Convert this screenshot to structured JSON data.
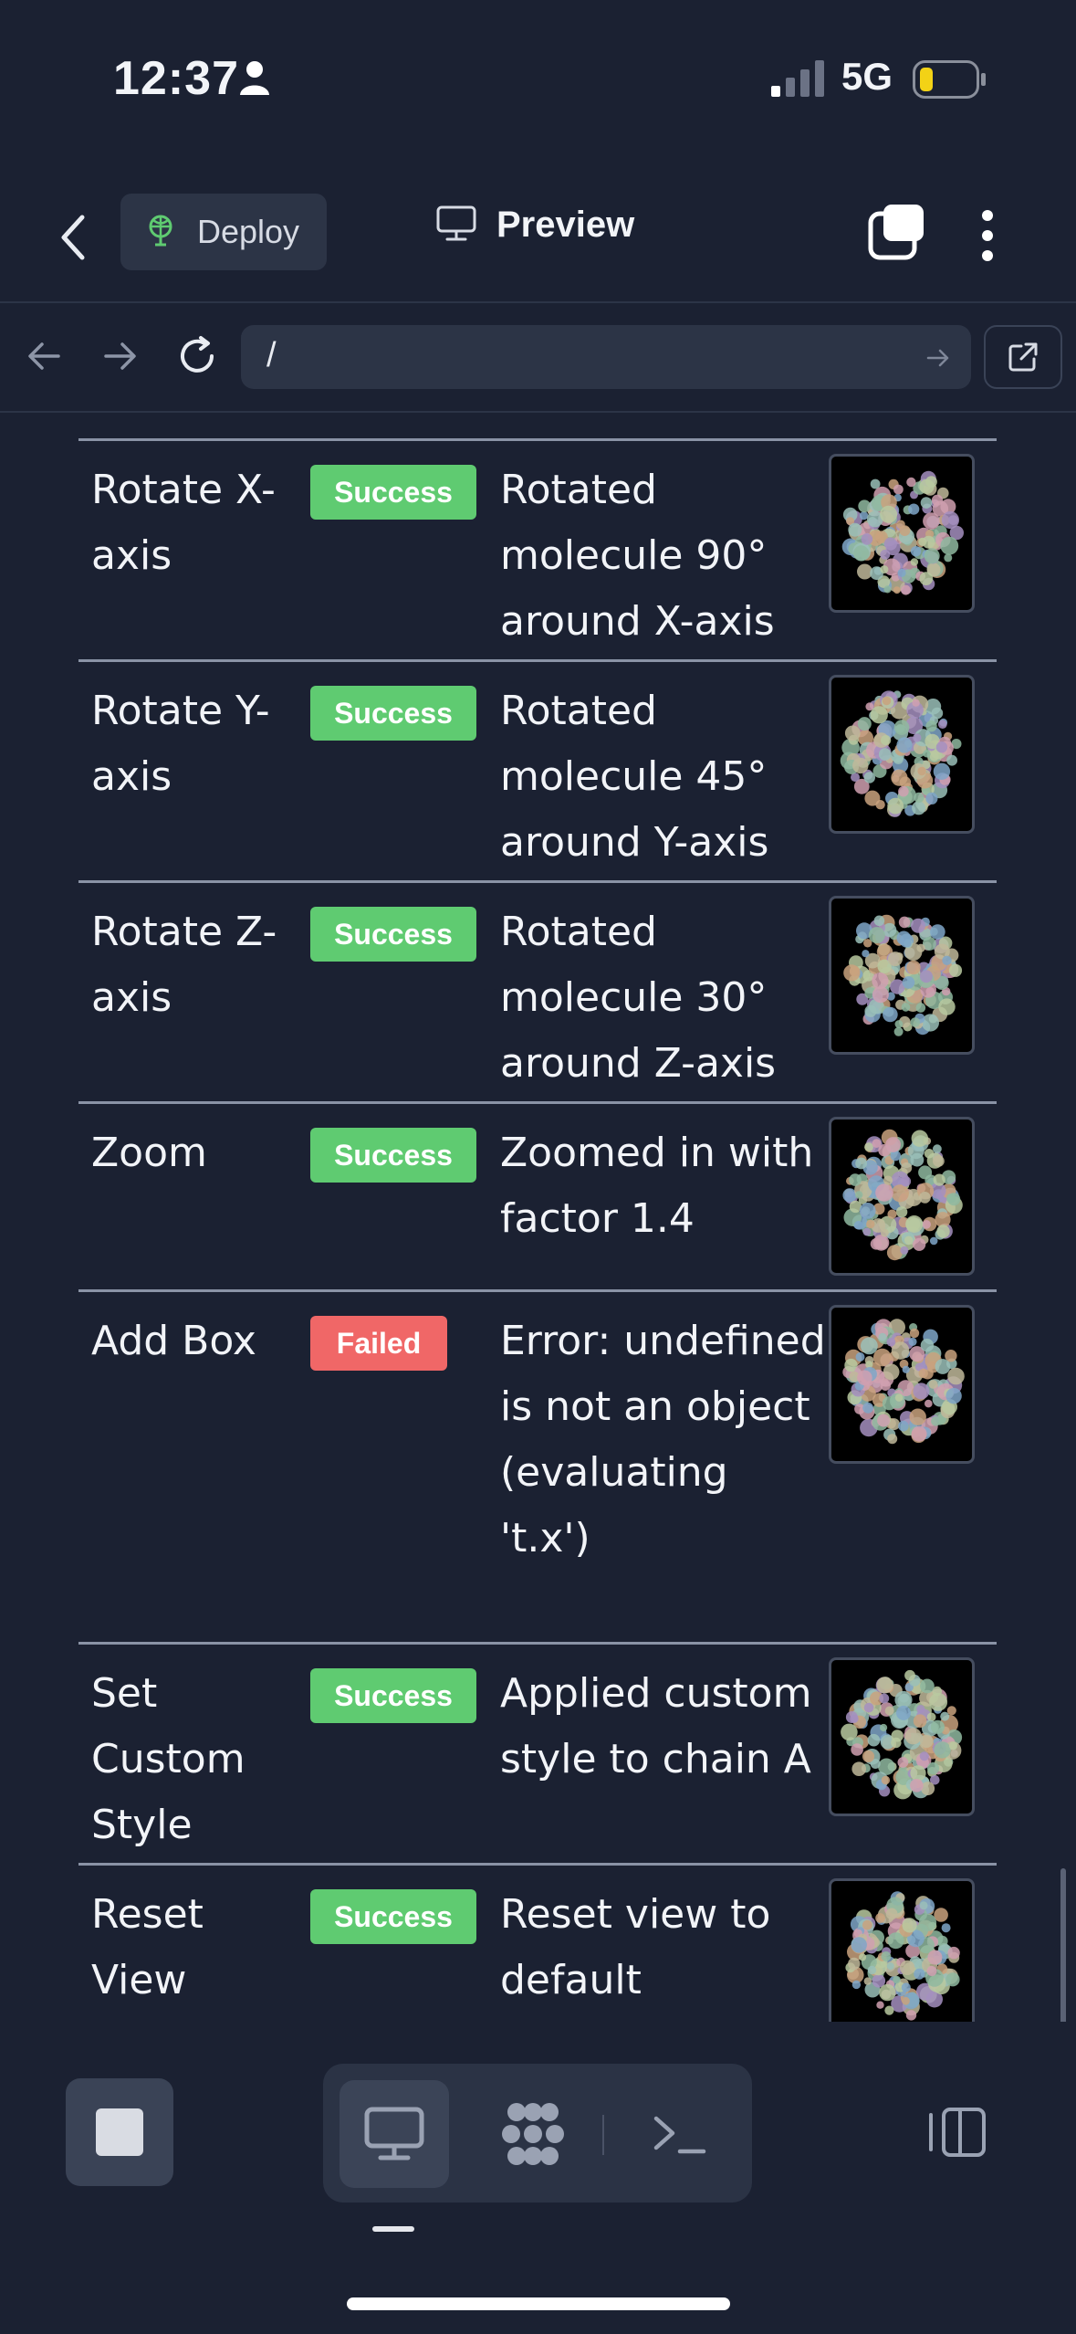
{
  "status_bar": {
    "time": "12:37",
    "network": "5G"
  },
  "header": {
    "deploy_label": "Deploy",
    "preview_label": "Preview"
  },
  "url_bar": {
    "path": "/"
  },
  "rows": [
    {
      "name": "Rotate X-axis",
      "status": "Success",
      "description": "Rotated molecule 90° around X-axis"
    },
    {
      "name": "Rotate Y-axis",
      "status": "Success",
      "description": "Rotated molecule 45° around Y-axis"
    },
    {
      "name": "Rotate Z-axis",
      "status": "Success",
      "description": "Rotated molecule 30° around Z-axis"
    },
    {
      "name": "Zoom",
      "status": "Success",
      "description": "Zoomed in with factor 1.4"
    },
    {
      "name": "Add Box",
      "status": "Failed",
      "description": "Error: undefined is not an object (evaluating 't.x')"
    },
    {
      "name": "Set Custom Style",
      "status": "Success",
      "description": "Applied custom style to chain A"
    },
    {
      "name": "Reset View",
      "status": "Success",
      "description": "Reset view to default"
    }
  ],
  "colors": {
    "success": "#5fcb71",
    "failed": "#f06767",
    "background": "#1b2132"
  },
  "icons": {
    "header": [
      "chevron-left-icon",
      "deploy-icon",
      "monitor-icon",
      "tabs-icon",
      "more-vertical-icon"
    ],
    "toolbar": [
      "stop-icon",
      "desktop-icon",
      "flower-icon",
      "terminal-icon",
      "panel-icon"
    ]
  }
}
